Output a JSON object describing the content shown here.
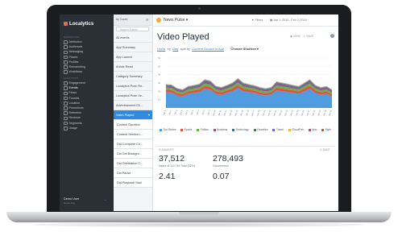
{
  "nav": {
    "logo": "Localytics",
    "section_top": "MARKETING",
    "items": [
      {
        "label": "Attribution",
        "top": 0
      },
      {
        "label": "Audiences"
      },
      {
        "label": "Messaging"
      },
      {
        "label": "Places"
      },
      {
        "label": "Profiles"
      },
      {
        "label": "Remarketing"
      },
      {
        "label": "Workflows"
      }
    ],
    "section_bottom": "ANALYTICS",
    "analytics_items": [
      {
        "label": "Engagement"
      },
      {
        "label": "Events"
      },
      {
        "label": "Flows"
      },
      {
        "label": "Funnels"
      },
      {
        "label": "Location"
      },
      {
        "label": "Promotions"
      },
      {
        "label": "Retention"
      },
      {
        "label": "Revenue"
      },
      {
        "label": "Segments"
      },
      {
        "label": "Usage"
      }
    ],
    "user_name": "Demo User",
    "user_sub": "Demo Org",
    "more": "..."
  },
  "list": {
    "sort_label": "by Count",
    "search_placeholder": "Search Events",
    "items": [
      "All events",
      "App Summary",
      "App Launch",
      "Article Read",
      "Category Summary",
      "Localytics Push Re...",
      "Localytics Push Ve...",
      "Advertisement Cli...",
      "Video Played"
    ],
    "sub_items": [
      "Content Duration",
      "Content Section i...",
      "Did Complete Co...",
      "Did Get Backgro...",
      "Did Orientation C...",
      "Did Pause",
      "Did Playback Stall"
    ]
  },
  "main": {
    "app_name": "News Pulse",
    "filters": "Filters",
    "date_range": "Jan 1, 2015 - Feb 2, 2015",
    "title": "Video Played",
    "view_action": "VIEW",
    "save_action": "SAVE",
    "help": "?",
    "query": {
      "metric": "Users",
      "by": "by",
      "interval": "Day",
      "split_by": "split by",
      "dimension": "Content Section in App",
      "extra": "Choose Shortcut"
    },
    "summary": {
      "title": "SUMMARY",
      "save": "SAVE",
      "metrics": [
        {
          "value": "37,512",
          "label": "Users of 119,749 Total (32%)"
        },
        {
          "value": "278,493",
          "label": "Occurrences"
        },
        {
          "value": "2.41",
          "label": ""
        },
        {
          "value": "0.07",
          "label": ""
        }
      ]
    }
  },
  "chart_data": {
    "type": "area",
    "stacked": true,
    "title": "",
    "xlabel": "",
    "ylabel": "",
    "ylim": [
      0,
      6000
    ],
    "yticks": [
      "6k",
      "5k",
      "4k",
      "3k",
      "2k",
      "1k"
    ],
    "x": [
      "Jan 1",
      "Jan 2",
      "Jan 3",
      "Jan 4",
      "Jan 5",
      "Jan 6",
      "Jan 7",
      "Jan 8",
      "Jan 9",
      "Jan 10",
      "Jan 11",
      "Jan 12",
      "Jan 13",
      "Jan 14",
      "Jan 15",
      "Jan 16",
      "Jan 17",
      "Jan 18",
      "Jan 19",
      "Jan 20",
      "Jan 21",
      "Jan 22",
      "Jan 23",
      "Jan 24",
      "Jan 25",
      "Jan 26",
      "Jan 27",
      "Jan 28",
      "Jan 29",
      "Jan 30",
      "Jan 31"
    ],
    "series": [
      {
        "name": "Top Stories",
        "color": "#4f9de0",
        "values": [
          1900,
          1850,
          1500,
          1400,
          1700,
          1800,
          1900,
          2300,
          2200,
          1700,
          1600,
          1800,
          2000,
          2400,
          2000,
          1900,
          1800,
          1600,
          1500,
          1600,
          2100,
          2000,
          1900,
          1800,
          1700,
          2000,
          2300,
          1800,
          1600,
          1700,
          1400
        ]
      },
      {
        "name": "Sports",
        "color": "#e2533b",
        "values": [
          300,
          300,
          280,
          260,
          290,
          300,
          310,
          350,
          330,
          300,
          280,
          300,
          320,
          360,
          320,
          300,
          290,
          280,
          270,
          280,
          330,
          320,
          310,
          300,
          290,
          320,
          350,
          300,
          280,
          290,
          260
        ]
      },
      {
        "name": "Politics",
        "color": "#6ab04c",
        "values": [
          250,
          250,
          230,
          220,
          240,
          250,
          260,
          300,
          290,
          250,
          240,
          250,
          270,
          310,
          270,
          250,
          240,
          230,
          220,
          230,
          280,
          270,
          260,
          250,
          240,
          270,
          300,
          250,
          230,
          240,
          220
        ]
      },
      {
        "name": "Business",
        "color": "#a04a8c",
        "values": [
          150,
          150,
          140,
          130,
          145,
          150,
          155,
          180,
          170,
          150,
          140,
          150,
          160,
          190,
          160,
          150,
          145,
          140,
          135,
          140,
          170,
          165,
          160,
          150,
          145,
          160,
          180,
          150,
          140,
          145,
          130
        ]
      },
      {
        "name": "Technology",
        "color": "#3d6a8e",
        "values": [
          100,
          100,
          90,
          85,
          95,
          100,
          105,
          120,
          115,
          100,
          95,
          100,
          110,
          125,
          110,
          100,
          95,
          90,
          88,
          90,
          115,
          110,
          105,
          100,
          95,
          110,
          120,
          100,
          90,
          95,
          85
        ]
      },
      {
        "name": "Favorites",
        "color": "#2e8b57",
        "values": [
          60,
          60,
          55,
          50,
          58,
          60,
          62,
          70,
          68,
          60,
          55,
          60,
          65,
          75,
          65,
          60,
          58,
          55,
          52,
          55,
          68,
          66,
          63,
          60,
          58,
          65,
          72,
          60,
          55,
          58,
          50
        ]
      },
      {
        "name": "Travel",
        "color": "#7a5fc9",
        "values": [
          40,
          40,
          36,
          34,
          38,
          40,
          42,
          48,
          46,
          40,
          36,
          40,
          44,
          50,
          44,
          40,
          38,
          36,
          35,
          36,
          46,
          44,
          42,
          40,
          38,
          44,
          48,
          40,
          36,
          38,
          34
        ]
      },
      {
        "name": "Cloud/Feb",
        "color": "#f0b43a",
        "values": [
          30,
          30,
          28,
          26,
          29,
          30,
          31,
          36,
          34,
          30,
          28,
          30,
          33,
          38,
          33,
          30,
          29,
          28,
          27,
          28,
          34,
          33,
          31,
          30,
          29,
          33,
          36,
          30,
          28,
          29,
          26
        ]
      },
      {
        "name": "Arts",
        "color": "#d43f6e",
        "values": [
          20,
          20,
          18,
          17,
          19,
          20,
          21,
          24,
          23,
          20,
          18,
          20,
          22,
          25,
          22,
          20,
          19,
          18,
          18,
          18,
          23,
          22,
          21,
          20,
          19,
          22,
          24,
          20,
          18,
          19,
          17
        ]
      },
      {
        "name": "Style",
        "color": "#b56a2c",
        "values": [
          10,
          10,
          9,
          9,
          10,
          10,
          10,
          12,
          11,
          10,
          9,
          10,
          11,
          12,
          11,
          10,
          10,
          9,
          9,
          9,
          11,
          11,
          10,
          10,
          10,
          11,
          12,
          10,
          9,
          10,
          9
        ]
      }
    ],
    "grid": true,
    "legend": "bottom"
  }
}
